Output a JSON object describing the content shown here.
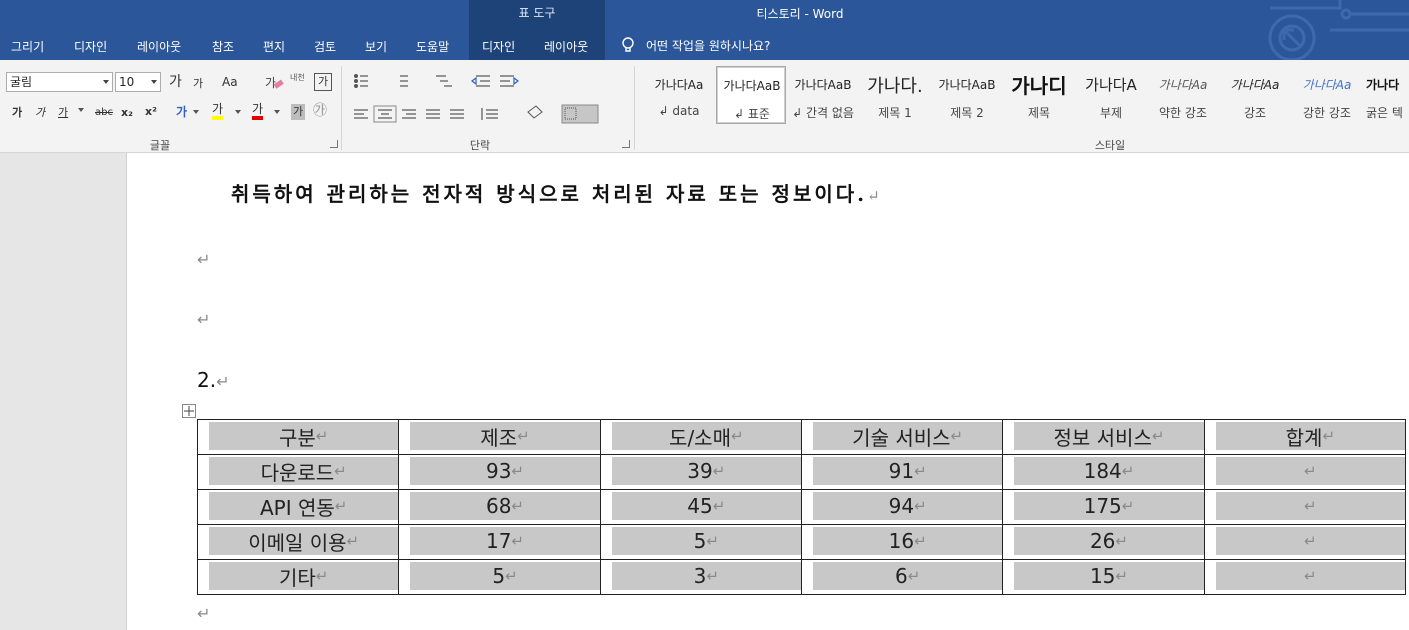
{
  "titlebar": {
    "context_tab_group": "표 도구",
    "document_title": "티스토리  -  Word"
  },
  "tabs": [
    "그리기",
    "디자인",
    "레이아웃",
    "참조",
    "편지",
    "검토",
    "보기",
    "도움말",
    "디자인",
    "레이아웃"
  ],
  "tell_me": "어떤 작업을 원하시나요?",
  "ribbon": {
    "font_name": "굴림",
    "font_size": "10",
    "group_font": "글꼴",
    "group_paragraph": "단락",
    "group_styles": "스타일",
    "btn_bold": "가",
    "btn_italic": "가",
    "btn_underline": "가",
    "btn_strike": "abc",
    "btn_sub": "x₂",
    "btn_sup": "x²",
    "btn_grow": "가",
    "btn_shrink": "가",
    "btn_case": "Aa",
    "btn_phonetic": "내천",
    "btn_charborder": "가",
    "btn_texteffect": "가",
    "btn_highlight": "가",
    "btn_fontcolor": "가",
    "btn_charshade": "가",
    "btn_enclose": "㉮"
  },
  "styles": [
    {
      "preview": "가나다Aa",
      "name": "data",
      "mark": "↲"
    },
    {
      "preview": "가나다AaB",
      "name": "표준",
      "mark": "↲"
    },
    {
      "preview": "가나다AaB",
      "name": "간격 없음",
      "mark": "↲"
    },
    {
      "preview": "가나다.",
      "name": "제목 1",
      "mark": ""
    },
    {
      "preview": "가나다AaB",
      "name": "제목 2",
      "mark": ""
    },
    {
      "preview": "가나디",
      "name": "제목",
      "mark": ""
    },
    {
      "preview": "가나다A",
      "name": "부제",
      "mark": ""
    },
    {
      "preview": "가나다Aa",
      "name": "약한 강조",
      "mark": ""
    },
    {
      "preview": "가나다Aa",
      "name": "강조",
      "mark": ""
    },
    {
      "preview": "가나다Aa",
      "name": "강한 강조",
      "mark": ""
    },
    {
      "preview": "가나다",
      "name": "굵은 텍",
      "mark": ""
    }
  ],
  "document": {
    "bold_line": "취득하여 관리하는 전자적 방식으로 처리된 자료 또는 정보이다.",
    "para_mark": "↵",
    "heading_number": "2."
  },
  "table": {
    "header": [
      "구분",
      "제조",
      "도/소매",
      "기술 서비스",
      "정보 서비스",
      "합계"
    ],
    "rows": [
      [
        "다운로드",
        "93",
        "39",
        "91",
        "184",
        ""
      ],
      [
        "API 연동",
        "68",
        "45",
        "94",
        "175",
        ""
      ],
      [
        "이메일 이용",
        "17",
        "5",
        "16",
        "26",
        ""
      ],
      [
        "기타",
        "5",
        "3",
        "6",
        "15",
        ""
      ]
    ]
  },
  "colors": {
    "titlebar": "#2b579a",
    "context_tab": "#1e4378",
    "ribbon": "#f3f3f3",
    "table_shade": "#c8c8c8"
  }
}
